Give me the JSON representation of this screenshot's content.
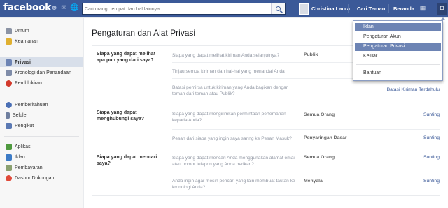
{
  "topbar": {
    "logo": "facebook",
    "search_placeholder": "Cari orang, tempat dan hal lainnya",
    "profile_name": "Christina Laura",
    "find_friends": "Cari Teman",
    "home": "Beranda"
  },
  "sidebar": {
    "items": [
      {
        "label": "Umum"
      },
      {
        "label": "Keamanan"
      },
      {
        "label": "Privasi"
      },
      {
        "label": "Kronologi dan Penandaan"
      },
      {
        "label": "Pemblokiran"
      },
      {
        "label": "Pemberitahuan"
      },
      {
        "label": "Seluler"
      },
      {
        "label": "Pengikut"
      },
      {
        "label": "Aplikasi"
      },
      {
        "label": "Iklan"
      },
      {
        "label": "Pembayaran"
      },
      {
        "label": "Dasbor Dukungan"
      }
    ]
  },
  "main": {
    "title": "Pengaturan dan Alat Privasi",
    "sections": [
      {
        "label": "Siapa yang dapat melihat apa pun yang dari saya?",
        "rows": [
          {
            "question": "Siapa yang dapat melihat kiriman Anda selanjutnya?",
            "value": "Publik",
            "action": ""
          },
          {
            "question": "Tinjau semua kiriman dan hal-hal yang menandai Anda",
            "value": "",
            "action": ""
          },
          {
            "question": "Batasi pemirsa untuk kiriman yang Anda bagikan dengan teman dari teman atau Publik?",
            "value": "",
            "action": "Batasi Kiriman Terdahulu"
          }
        ]
      },
      {
        "label": "Siapa yang dapat menghubungi saya?",
        "rows": [
          {
            "question": "Siapa yang dapat mengirimkan permintaan pertemanan kepada Anda?",
            "value": "Semua Orang",
            "action": "Sunting"
          },
          {
            "question": "Pesan dari siapa yang ingin saya saring ke Pesan Masuk?",
            "value": "Penyaringan Dasar",
            "action": "Sunting"
          }
        ]
      },
      {
        "label": "Siapa yang dapat mencari saya?",
        "rows": [
          {
            "question": "Siapa yang dapat mencari Anda menggunakan alamat email atau nomor telepon yang Anda berikan?",
            "value": "Semua Orang",
            "action": "Sunting"
          },
          {
            "question": "Anda ingin agar mesin pencari yang lain membuat tautan ke kronologi Anda?",
            "value": "Menyala",
            "action": "Sunting"
          }
        ]
      }
    ]
  },
  "dropdown": {
    "items": [
      {
        "label": "Iklan"
      },
      {
        "label": "Pengaturan Akun"
      },
      {
        "label": "Pengaturan Privasi"
      },
      {
        "label": "Keluar"
      },
      {
        "label": "Bantuan"
      }
    ]
  },
  "colors": {
    "brand": "#3b5998",
    "highlight": "#6d84b4",
    "link": "#3b5998"
  }
}
